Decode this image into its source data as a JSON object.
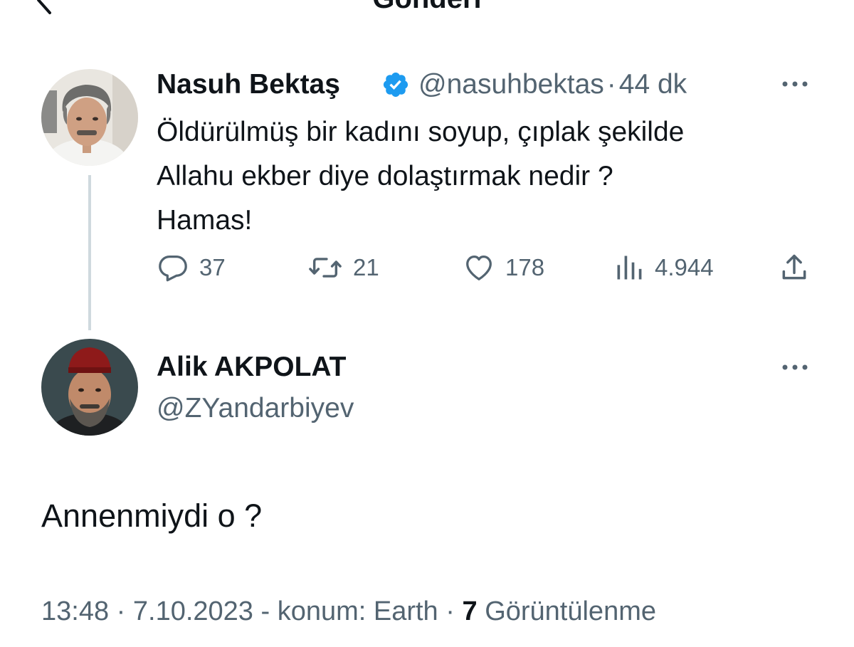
{
  "header": {
    "title": "Gönderi",
    "back_icon": "chevron-left-icon"
  },
  "parent_tweet": {
    "author_name": "Nasuh Bektaş",
    "verified_icon": "verified-badge-icon",
    "handle": "@nasuhbektas",
    "separator": "·",
    "time": "44 dk",
    "text_lines": [
      "Öldürülmüş bir kadını soyup, çıplak şekilde",
      "Allahu ekber diye dolaştırmak nedir ?",
      "Hamas!"
    ],
    "actions": {
      "replies": "37",
      "retweets": "21",
      "likes": "178",
      "views": "4.944"
    }
  },
  "reply_tweet": {
    "author_name": "Alik AKPOLAT",
    "handle": "@ZYandarbiyev",
    "text": "Annenmiydi o ?",
    "time": "13:48",
    "sep1": "·",
    "date_location": "7.10.2023 - konum: Earth",
    "sep2": "·",
    "views_count": "7",
    "views_label": "Görüntülenme"
  },
  "colors": {
    "text": "#0f1419",
    "secondary": "#536471",
    "verified": "#1d9bf0",
    "thread_line": "#cfd9de"
  }
}
